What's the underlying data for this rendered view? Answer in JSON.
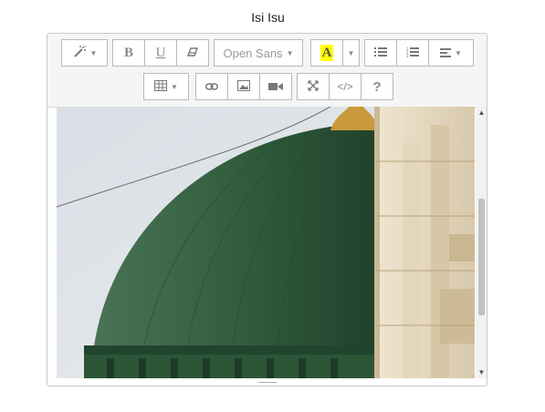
{
  "field": {
    "label": "Isi Isu"
  },
  "toolbar": {
    "style_button": {
      "icon": "magic-wand-icon"
    },
    "bold_label": "B",
    "underline_label": "U",
    "clear_format": {
      "icon": "eraser-icon"
    },
    "font_family": "Open Sans",
    "highlight": {
      "label": "A",
      "color": "#ffff00"
    },
    "unordered_list": {
      "icon": "bullet-list-icon"
    },
    "ordered_list": {
      "icon": "numbered-list-icon"
    },
    "paragraph": {
      "icon": "align-left-icon"
    },
    "table": {
      "icon": "table-icon"
    },
    "link": {
      "icon": "link-icon"
    },
    "picture": {
      "icon": "picture-icon"
    },
    "video": {
      "icon": "video-icon"
    },
    "fullscreen": {
      "icon": "expand-icon"
    },
    "codeview_label": "</>",
    "help_label": "?"
  },
  "content": {
    "image": {
      "subject": "green-dome-photo",
      "colors": {
        "sky": "#e3e7ea",
        "dome": "#2f5b3c",
        "wall": "#e7dcc6"
      }
    }
  }
}
